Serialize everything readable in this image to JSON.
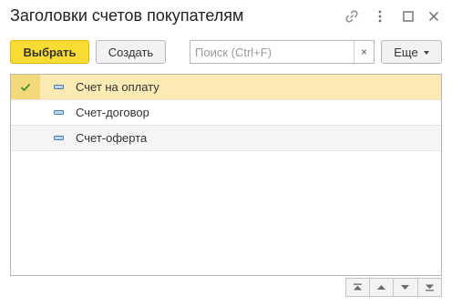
{
  "window": {
    "title": "Заголовки счетов покупателям",
    "icons": [
      "link-icon",
      "more-vertical-icon",
      "maximize-icon",
      "close-icon"
    ]
  },
  "toolbar": {
    "select_label": "Выбрать",
    "create_label": "Создать",
    "search_placeholder": "Поиск (Ctrl+F)",
    "search_value": "",
    "clear_label": "×",
    "more_label": "Еще"
  },
  "list": {
    "rows": [
      {
        "label": "Счет на оплату",
        "selected": true,
        "icon": "document-icon"
      },
      {
        "label": "Счет-договор",
        "selected": false,
        "icon": "document-icon"
      },
      {
        "label": "Счет-оферта",
        "selected": false,
        "icon": "document-icon"
      }
    ]
  },
  "colors": {
    "primary_button": "#f8dc34",
    "selected_row": "#fbeab3",
    "check_mark": "#3f8f2f"
  },
  "navigation": [
    "go-first-icon",
    "go-up-icon",
    "go-down-icon",
    "go-last-icon"
  ]
}
